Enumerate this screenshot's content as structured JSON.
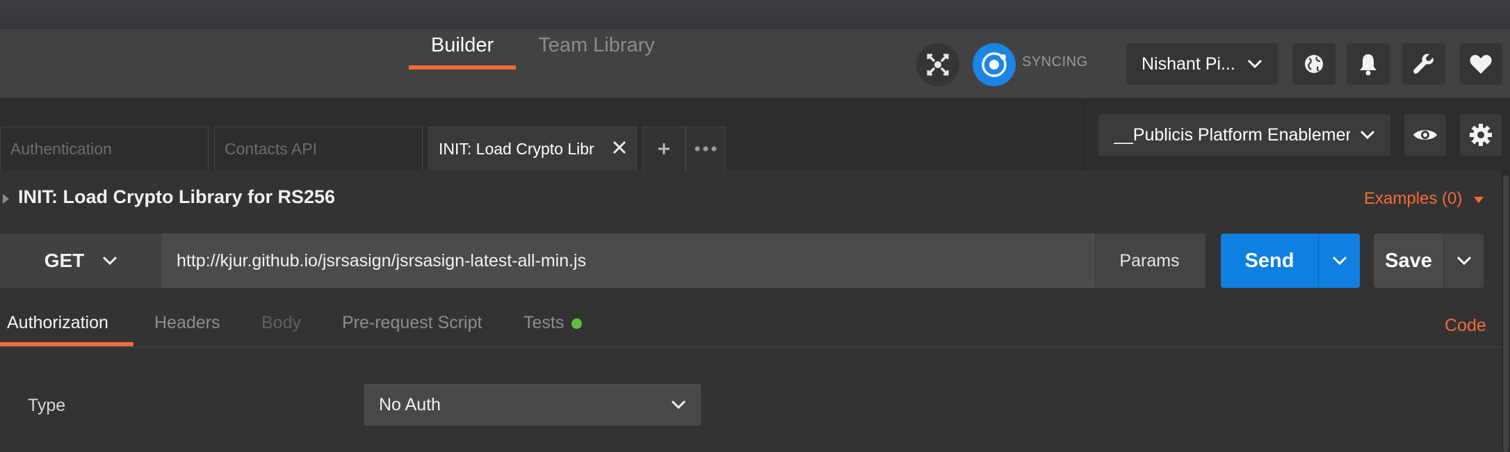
{
  "header": {
    "tabs": [
      {
        "label": "Builder",
        "active": true
      },
      {
        "label": "Team Library",
        "active": false
      }
    ],
    "sync_status": "SYNCING",
    "user_name": "Nishant Pi...",
    "icons": [
      "capture-icon",
      "sync-icon",
      "globe-icon",
      "bell-icon",
      "wrench-icon",
      "heart-icon"
    ]
  },
  "request_tabs": [
    {
      "label": "Authentication"
    },
    {
      "label": "Contacts API"
    },
    {
      "label": "INIT: Load Crypto Libr",
      "active": true
    }
  ],
  "environment": {
    "selected": "__Publicis Platform Enablemer"
  },
  "request": {
    "title": "INIT: Load Crypto Library for RS256",
    "examples_label": "Examples (0)",
    "method": "GET",
    "url": "http://kjur.github.io/jsrsasign/jsrsasign-latest-all-min.js",
    "params_label": "Params",
    "send_label": "Send",
    "save_label": "Save"
  },
  "subtabs": {
    "authorization": "Authorization",
    "headers": "Headers",
    "body": "Body",
    "pre_request": "Pre-request Script",
    "tests": "Tests",
    "code": "Code"
  },
  "auth": {
    "type_label": "Type",
    "type_value": "No Auth"
  },
  "colors": {
    "accent": "#f26b3a",
    "primary": "#0f7fe0",
    "tests_indicator": "#5cc23c"
  }
}
